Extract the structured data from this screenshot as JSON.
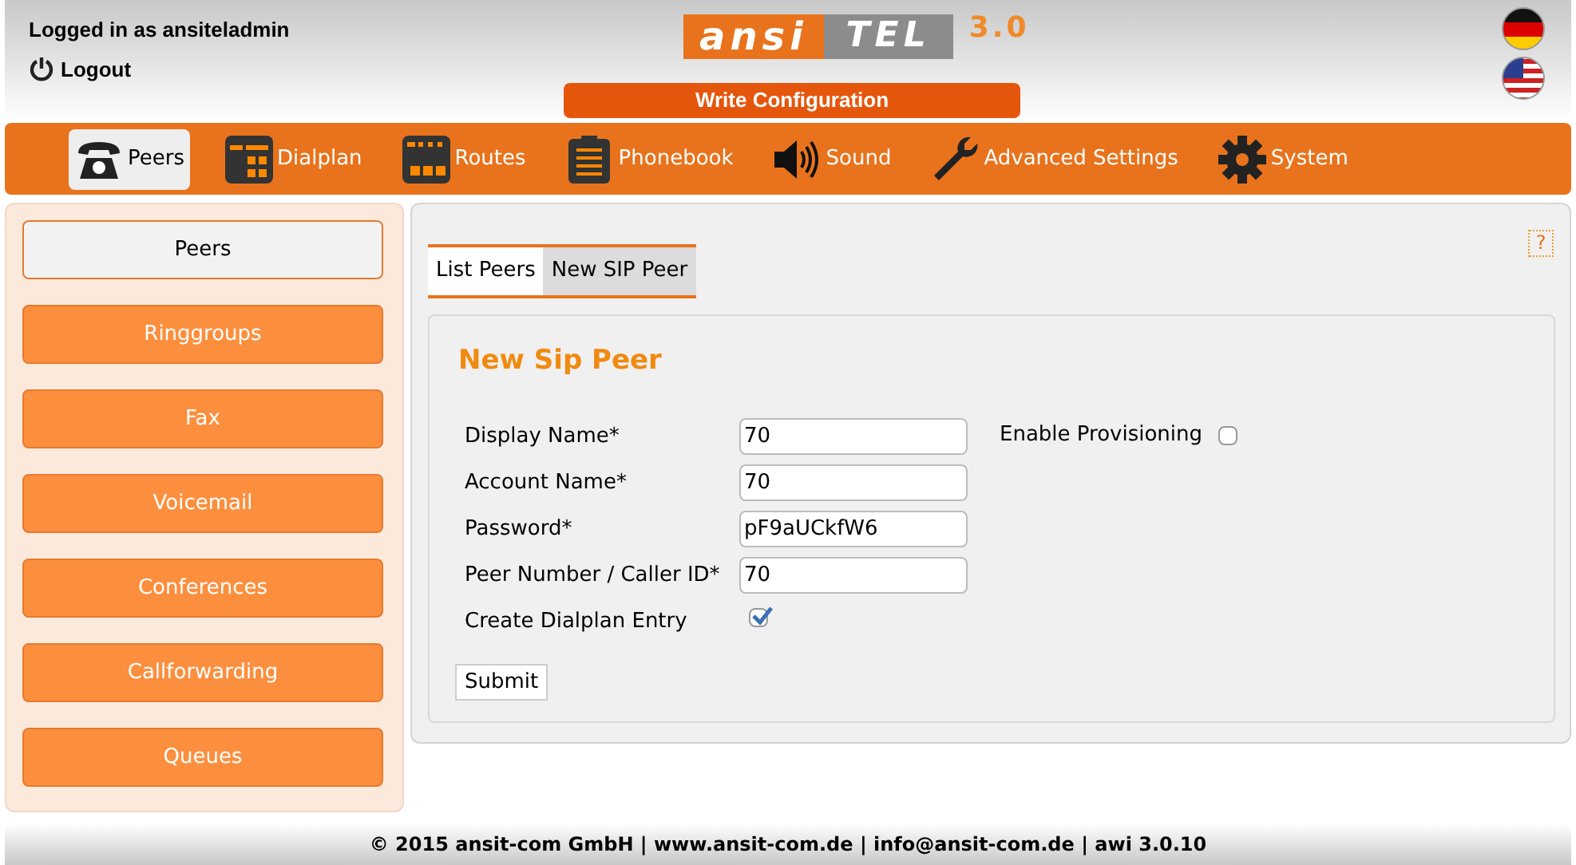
{
  "user": {
    "logged_in": "Logged in as ansiteladmin",
    "logout": "Logout"
  },
  "logo": {
    "left": "ansi",
    "right": "TEL",
    "version": "3.0"
  },
  "write_button": "Write Configuration",
  "nav": [
    {
      "label": "Peers",
      "selected": true
    },
    {
      "label": "Dialplan",
      "selected": false
    },
    {
      "label": "Routes",
      "selected": false
    },
    {
      "label": "Phonebook",
      "selected": false
    },
    {
      "label": "Sound",
      "selected": false
    },
    {
      "label": "Advanced Settings",
      "selected": false
    },
    {
      "label": "System",
      "selected": false
    }
  ],
  "sidebar": [
    {
      "label": "Peers",
      "selected": true
    },
    {
      "label": "Ringgroups",
      "selected": false
    },
    {
      "label": "Fax",
      "selected": false
    },
    {
      "label": "Voicemail",
      "selected": false
    },
    {
      "label": "Conferences",
      "selected": false
    },
    {
      "label": "Callforwarding",
      "selected": false
    },
    {
      "label": "Queues",
      "selected": false
    }
  ],
  "help": "?",
  "tabs": [
    {
      "label": "List Peers",
      "selected": false
    },
    {
      "label": "New SIP Peer",
      "selected": true
    }
  ],
  "form": {
    "title": "New Sip Peer",
    "fields": [
      {
        "kind": "text",
        "label": "Display Name*",
        "value": "70"
      },
      {
        "kind": "text",
        "label": "Account Name*",
        "value": "70"
      },
      {
        "kind": "text",
        "label": "Password*",
        "value": "pF9aUCkfW6"
      },
      {
        "kind": "text",
        "label": "Peer Number / Caller ID*",
        "value": "70"
      },
      {
        "kind": "checkbox",
        "label": "Create Dialplan Entry",
        "checked": true
      }
    ],
    "provisioning": {
      "label": "Enable Provisioning",
      "checked": false
    },
    "submit": "Submit"
  },
  "footer": "© 2015 ansit-com GmbH | www.ansit-com.de | info@ansit-com.de | awi 3.0.10"
}
